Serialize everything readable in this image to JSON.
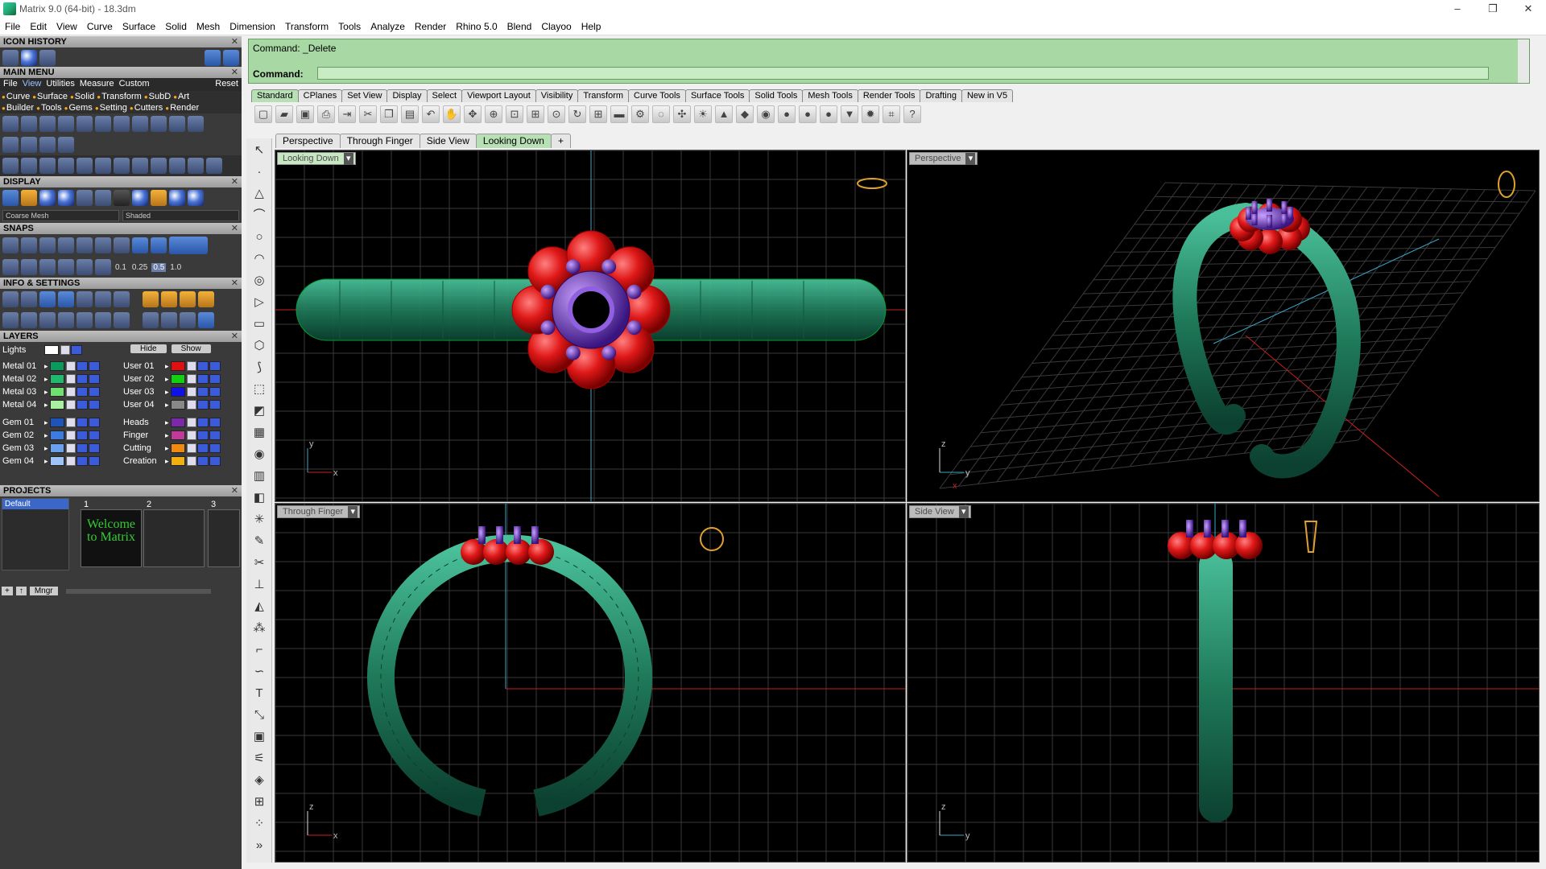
{
  "window": {
    "title": "Matrix 9.0 (64-bit) - 18.3dm",
    "buttons": [
      "–",
      "❐",
      "✕"
    ]
  },
  "menubar": {
    "items": [
      "File",
      "Edit",
      "View",
      "Curve",
      "Surface",
      "Solid",
      "Mesh",
      "Dimension",
      "Transform",
      "Tools",
      "Analyze",
      "Render",
      "Rhino 5.0",
      "Blend",
      "Clayoo",
      "Help"
    ]
  },
  "left_panel": {
    "icon_history_title": "ICON HISTORY",
    "main_menu_title": "MAIN MENU",
    "main_menu_tabs": [
      "File",
      "View",
      "Utilities",
      "Measure",
      "Custom",
      "Reset"
    ],
    "main_menu_selected_tab": "View",
    "main_menu_row1": [
      "Curve",
      "Surface",
      "Solid",
      "Transform",
      "SubD",
      "Art"
    ],
    "main_menu_row2": [
      "Builder",
      "Tools",
      "Gems",
      "Setting",
      "Cutters",
      "Render"
    ],
    "display_title": "DISPLAY",
    "display_mesh": "Coarse Mesh",
    "display_mode": "Shaded",
    "snaps_title": "SNAPS",
    "snap_values": [
      "0.1",
      "0.25",
      "0.5",
      "1.0"
    ],
    "info_title": "INFO & SETTINGS",
    "layers_title": "LAYERS",
    "layers_hide": "Hide",
    "layers_show": "Show",
    "lights_label": "Lights",
    "layers_left": [
      {
        "name": "Metal 01",
        "color": "#0c9a5c"
      },
      {
        "name": "Metal 02",
        "color": "#1fb86c"
      },
      {
        "name": "Metal 03",
        "color": "#6ee06e"
      },
      {
        "name": "Metal 04",
        "color": "#a8f0a0"
      },
      {
        "name": "Gem 01",
        "color": "#1d54b8"
      },
      {
        "name": "Gem 02",
        "color": "#3c7ce0"
      },
      {
        "name": "Gem 03",
        "color": "#6aa0f0"
      },
      {
        "name": "Gem 04",
        "color": "#9cc4f8"
      }
    ],
    "layers_right": [
      {
        "name": "User 01",
        "color": "#e01010"
      },
      {
        "name": "User 02",
        "color": "#10d010"
      },
      {
        "name": "User 03",
        "color": "#1010e8"
      },
      {
        "name": "User 04",
        "color": "#888888"
      },
      {
        "name": "Heads",
        "color": "#7a2aa8"
      },
      {
        "name": "Finger",
        "color": "#c03a9a"
      },
      {
        "name": "Cutting",
        "color": "#f08a10"
      },
      {
        "name": "Creation",
        "color": "#f0b010"
      }
    ],
    "projects_title": "PROJECTS",
    "project_name": "Default",
    "project_slots": [
      "1",
      "2",
      "3"
    ],
    "project_thumb_text": "Welcome to Matrix",
    "mngr_label": "Mngr"
  },
  "command": {
    "history_line": "Command: _Delete",
    "prompt_label": "Command:",
    "input_value": ""
  },
  "toolbar_tabs": [
    "Standard",
    "CPlanes",
    "Set View",
    "Display",
    "Select",
    "Viewport Layout",
    "Visibility",
    "Transform",
    "Curve Tools",
    "Surface Tools",
    "Solid Tools",
    "Mesh Tools",
    "Render Tools",
    "Drafting",
    "New in V5"
  ],
  "toolbar_selected": "Standard",
  "viewport_tabs": [
    "Perspective",
    "Through Finger",
    "Side View",
    "Looking Down",
    "+"
  ],
  "viewport_selected": "Looking Down",
  "viewports": {
    "top_left": {
      "label": "Looking Down",
      "axes": [
        "y",
        "x"
      ]
    },
    "top_right": {
      "label": "Perspective",
      "axes": [
        "z",
        "y",
        "x"
      ]
    },
    "bottom_left": {
      "label": "Through Finger",
      "axes": [
        "z",
        "x"
      ]
    },
    "bottom_right": {
      "label": "Side View",
      "axes": [
        "z",
        "y"
      ]
    }
  },
  "colors": {
    "ring": "#1f7a5a",
    "ring_light": "#2e9e76",
    "gem_red": "#e01818",
    "prong_purple": "#7a3ad0",
    "command_bg": "#a8d8a4",
    "grid": "#3a3a3a"
  }
}
